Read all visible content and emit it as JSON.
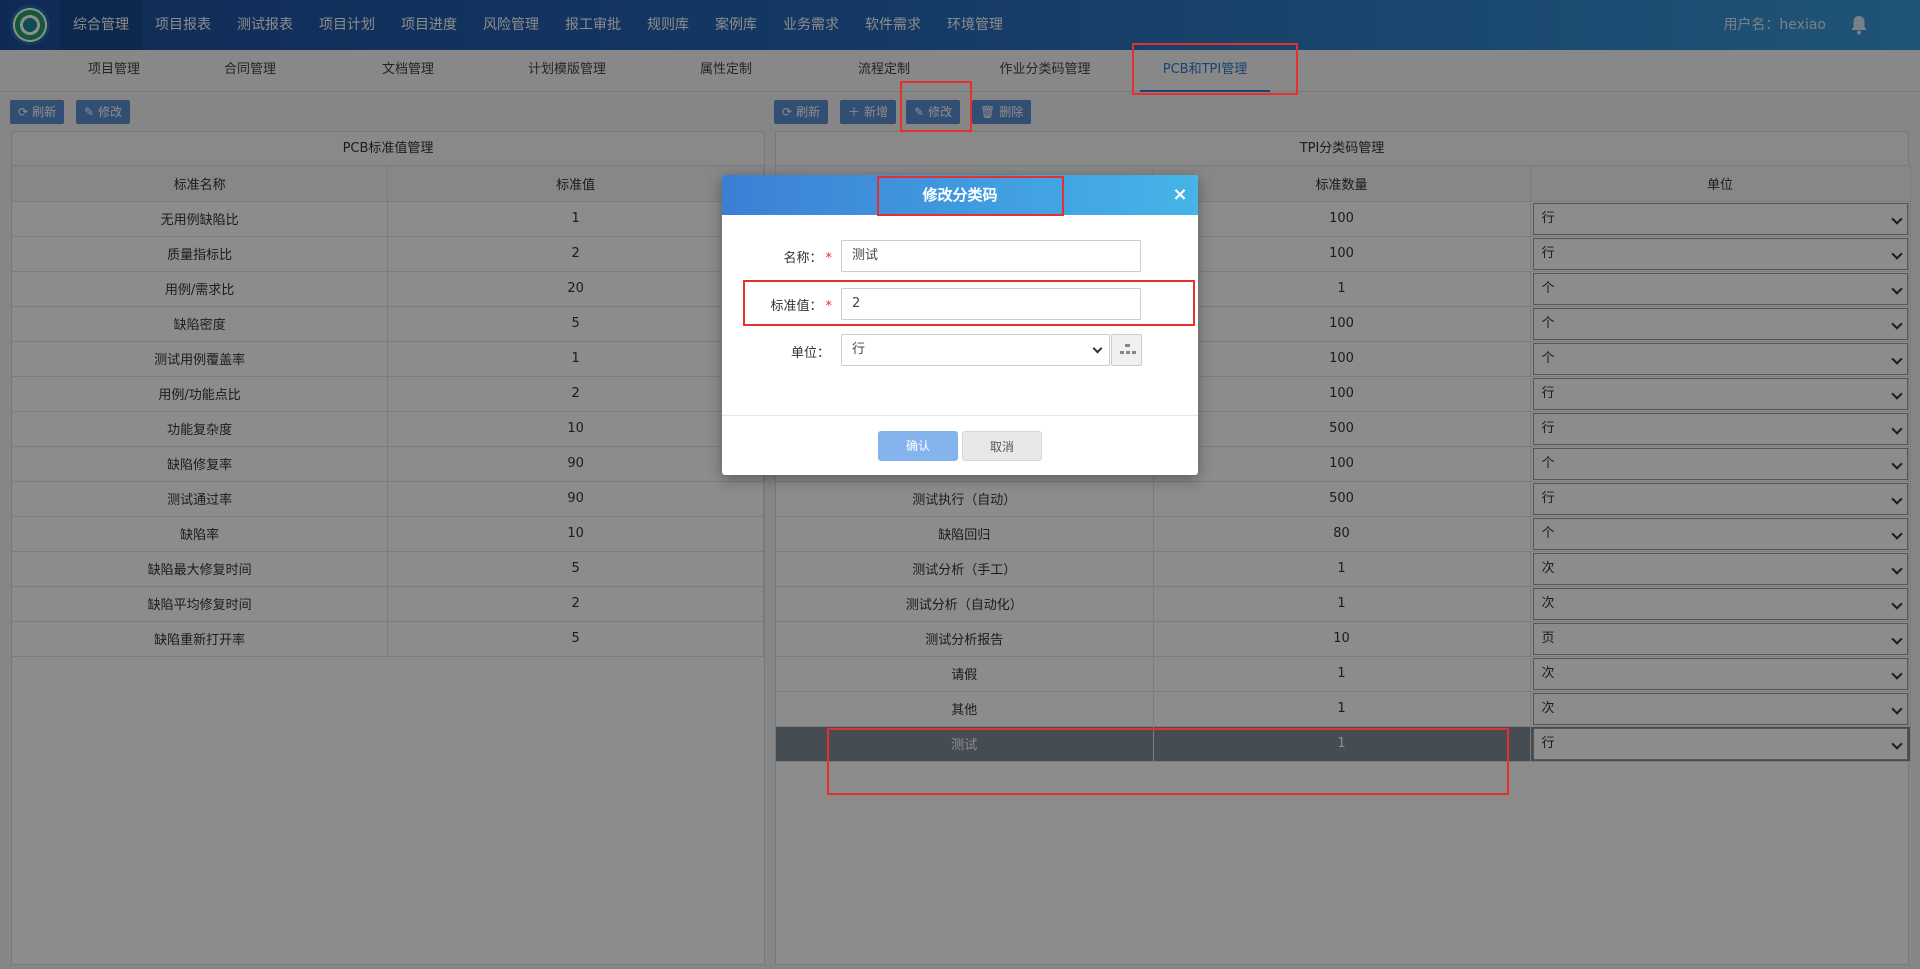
{
  "topnav": {
    "items": [
      "综合管理",
      "项目报表",
      "测试报表",
      "项目计划",
      "项目进度",
      "风险管理",
      "报工审批",
      "规则库",
      "案例库",
      "业务需求",
      "软件需求",
      "环境管理"
    ],
    "user_label": "用户名：hexiao"
  },
  "subnav": {
    "tabs": [
      "项目管理",
      "合同管理",
      "文档管理",
      "计划模版管理",
      "属性定制",
      "流程定制",
      "作业分类码管理",
      "PCB和TPI管理"
    ]
  },
  "left_toolbar": {
    "refresh": "刷新",
    "edit": "修改"
  },
  "right_toolbar": {
    "refresh": "刷新",
    "add": "新增",
    "edit": "修改",
    "delete": "删除"
  },
  "pcb": {
    "title": "PCB标准值管理",
    "headers": [
      "标准名称",
      "标准值"
    ],
    "rows": [
      [
        "无用例缺陷比",
        "1"
      ],
      [
        "质量指标比",
        "2"
      ],
      [
        "用例/需求比",
        "20"
      ],
      [
        "缺陷密度",
        "5"
      ],
      [
        "测试用例覆盖率",
        "1"
      ],
      [
        "用例/功能点比",
        "2"
      ],
      [
        "功能复杂度",
        "10"
      ],
      [
        "缺陷修复率",
        "90"
      ],
      [
        "测试通过率",
        "90"
      ],
      [
        "缺陷率",
        "10"
      ],
      [
        "缺陷最大修复时间",
        "5"
      ],
      [
        "缺陷平均修复时间",
        "2"
      ],
      [
        "缺陷重新打开率",
        "5"
      ]
    ]
  },
  "tpi": {
    "title": "TPI分类码管理",
    "headers": [
      "",
      "标准数量",
      "单位"
    ],
    "rows": [
      [
        "",
        "100",
        "行"
      ],
      [
        "",
        "100",
        "行"
      ],
      [
        "",
        "1",
        "个"
      ],
      [
        "",
        "100",
        "个"
      ],
      [
        "",
        "100",
        "个"
      ],
      [
        "",
        "100",
        "行"
      ],
      [
        "",
        "500",
        "行"
      ],
      [
        "",
        "100",
        "个"
      ],
      [
        "测试执行（自动）",
        "500",
        "行"
      ],
      [
        "缺陷回归",
        "80",
        "个"
      ],
      [
        "测试分析（手工）",
        "1",
        "次"
      ],
      [
        "测试分析（自动化）",
        "1",
        "次"
      ],
      [
        "测试分析报告",
        "10",
        "页"
      ],
      [
        "请假",
        "1",
        "次"
      ],
      [
        "其他",
        "1",
        "次"
      ],
      [
        "测试",
        "1",
        "行"
      ]
    ]
  },
  "dialog": {
    "title": "修改分类码",
    "name_label": "名称：",
    "name_value": "测试",
    "std_label": "标准值：",
    "std_value": "2",
    "unit_label": "单位：",
    "unit_value": "行",
    "confirm": "确认",
    "cancel": "取消"
  },
  "colors": {
    "accent": "#2f7ad0",
    "highlight": "#e53030",
    "button": "#5b8fd0"
  }
}
